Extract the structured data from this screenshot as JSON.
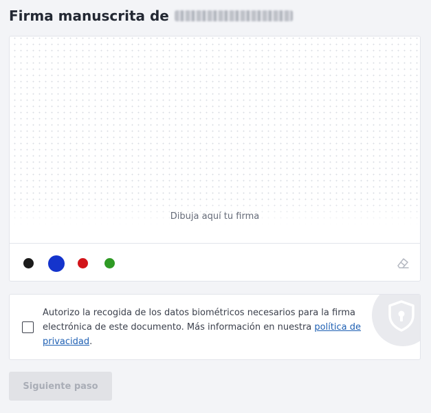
{
  "header": {
    "title": "Firma manuscrita de",
    "name_redacted": true
  },
  "signature_pad": {
    "hint": "Dibuja aquí tu firma",
    "colors": [
      {
        "name": "black",
        "hex": "#1b1b1b",
        "selected": false
      },
      {
        "name": "blue",
        "hex": "#1434cc",
        "selected": true
      },
      {
        "name": "red",
        "hex": "#d2141a",
        "selected": false
      },
      {
        "name": "green",
        "hex": "#2e9a24",
        "selected": false
      }
    ],
    "clear_icon": "eraser-icon"
  },
  "consent": {
    "checked": false,
    "text": "Autorizo la recogida de los datos biométricos necesarios para la firma electrónica de este documento. Más información en nuestra ",
    "link_text": "política de privacidad",
    "after_link": ".",
    "icon": "shield-lock-icon"
  },
  "actions": {
    "next_label": "Siguiente paso",
    "next_disabled": true
  }
}
